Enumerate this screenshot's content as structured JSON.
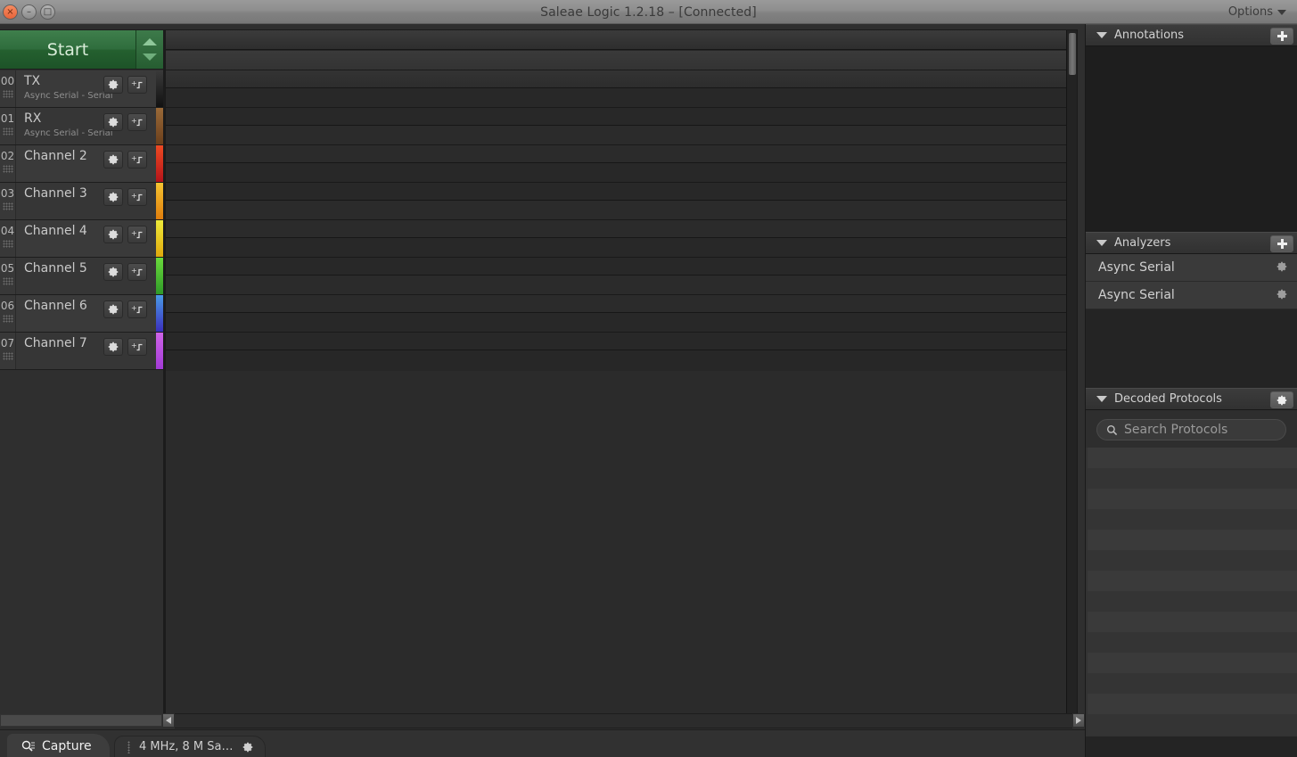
{
  "window": {
    "title": "Saleae Logic 1.2.18 – [Connected]",
    "options_label": "Options",
    "close_glyph": "×",
    "minimize_glyph": "–",
    "maximize_glyph": "□"
  },
  "capture": {
    "start_label": "Start",
    "up_arrow_name": "scroll-up",
    "down_arrow_name": "scroll-down"
  },
  "channels": [
    {
      "number": "00",
      "name": "TX",
      "analyzer": "Async Serial - Serial",
      "color": "#2b2b2b"
    },
    {
      "number": "01",
      "name": "RX",
      "analyzer": "Async Serial - Serial",
      "color": "#8a5a30"
    },
    {
      "number": "02",
      "name": "Channel 2",
      "analyzer": "",
      "color": "#d62b1f"
    },
    {
      "number": "03",
      "name": "Channel 3",
      "analyzer": "",
      "color": "#e8930f"
    },
    {
      "number": "04",
      "name": "Channel 4",
      "analyzer": "",
      "color": "#e6d21a"
    },
    {
      "number": "05",
      "name": "Channel 5",
      "analyzer": "",
      "color": "#4bbd3a"
    },
    {
      "number": "06",
      "name": "Channel 6",
      "analyzer": "",
      "color": "#3b74d6"
    },
    {
      "number": "07",
      "name": "Channel 7",
      "analyzer": "",
      "color": "#b44fd6"
    }
  ],
  "sidebar": {
    "annotations": {
      "title": "Annotations",
      "add_label": "add-annotation"
    },
    "analyzers": {
      "title": "Analyzers",
      "add_label": "add-analyzer",
      "items": [
        {
          "name": "Async Serial"
        },
        {
          "name": "Async Serial"
        }
      ]
    },
    "decoded_protocols": {
      "title": "Decoded Protocols",
      "search_placeholder": "Search Protocols"
    }
  },
  "bottom": {
    "capture_tab": "Capture",
    "settings_tab": "4 MHz, 8 M Sa…"
  },
  "colors": {
    "accent_green": "#2f6d3d",
    "titlebar": "#8e8e8e",
    "panel_bg": "#242424"
  }
}
